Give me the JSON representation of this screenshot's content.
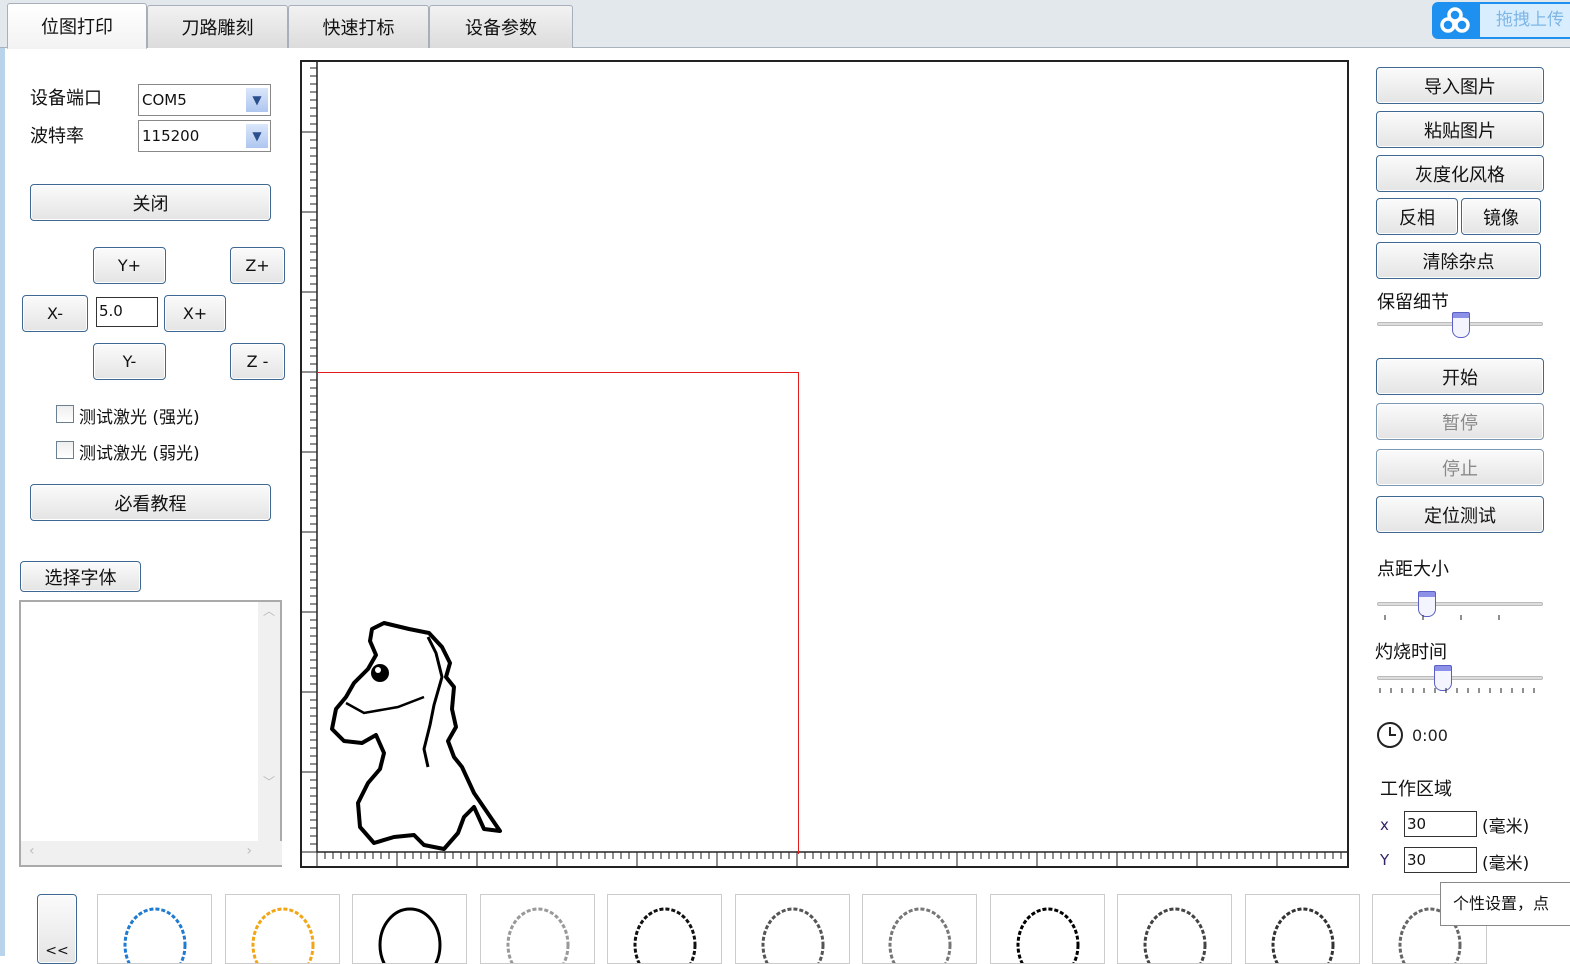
{
  "tabs": [
    "位图打印",
    "刀路雕刻",
    "快速打标",
    "设备参数"
  ],
  "upload_label": "拖拽上传",
  "left": {
    "port_label": "设备端口",
    "port_value": "COM5",
    "baud_label": "波特率",
    "baud_value": "115200",
    "close_button": "关闭",
    "jog": {
      "y_plus": "Y+",
      "z_plus": "Z+",
      "x_minus": "X-",
      "step": "5.0",
      "x_plus": "X+",
      "y_minus": "Y-",
      "z_minus": "Z -"
    },
    "test_strong": "测试激光 (强光)",
    "test_weak": "测试激光 (弱光)",
    "tutorial_button": "必看教程",
    "font_button": "选择字体"
  },
  "right": {
    "import": "导入图片",
    "paste": "粘贴图片",
    "gray": "灰度化风格",
    "invert": "反相",
    "mirror": "镜像",
    "denoise": "清除杂点",
    "detail_label": "保留细节",
    "detail_level": 0.5,
    "start": "开始",
    "pause": "暂停",
    "stop": "停止",
    "locate": "定位测试",
    "dot_label": "点距大小",
    "dot_level": 0.27,
    "burn_label": "灼烧时间",
    "burn_level": 0.38,
    "time": "0:00",
    "work_label": "工作区域",
    "x_label": "x",
    "x_value": "30",
    "y_label": "Y",
    "y_value": "30",
    "unit": "(毫米)"
  },
  "gallery": {
    "prev": "<<",
    "tooltip": "个性设置，点"
  }
}
